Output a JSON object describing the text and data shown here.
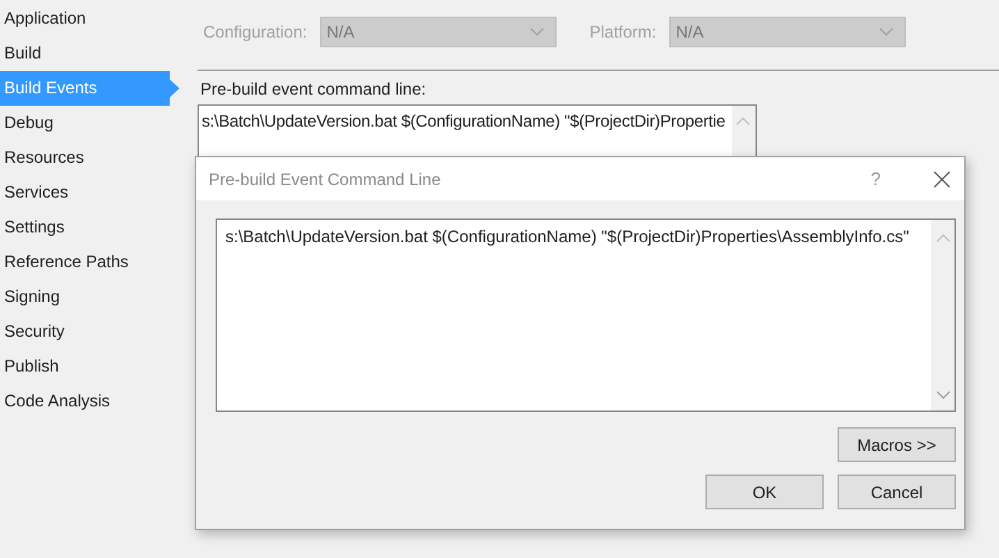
{
  "sidebar": {
    "items": [
      {
        "label": "Application",
        "selected": false
      },
      {
        "label": "Build",
        "selected": false
      },
      {
        "label": "Build Events",
        "selected": true
      },
      {
        "label": "Debug",
        "selected": false
      },
      {
        "label": "Resources",
        "selected": false
      },
      {
        "label": "Services",
        "selected": false
      },
      {
        "label": "Settings",
        "selected": false
      },
      {
        "label": "Reference Paths",
        "selected": false
      },
      {
        "label": "Signing",
        "selected": false
      },
      {
        "label": "Security",
        "selected": false
      },
      {
        "label": "Publish",
        "selected": false
      },
      {
        "label": "Code Analysis",
        "selected": false
      }
    ]
  },
  "selectors": [
    {
      "label": "Configuration:",
      "value": "N/A",
      "disabled": true
    },
    {
      "label": "Platform:",
      "value": "N/A",
      "disabled": true
    }
  ],
  "prebuild": {
    "label": "Pre-build event command line:",
    "value": "s:\\Batch\\UpdateVersion.bat $(ConfigurationName) \"$(ProjectDir)Propertie"
  },
  "dialog": {
    "title": "Pre-build Event Command Line",
    "help": "?",
    "value": "s:\\Batch\\UpdateVersion.bat $(ConfigurationName) \"$(ProjectDir)Properties\\AssemblyInfo.cs\"",
    "macros_button": "Macros >>",
    "buttons": [
      "OK",
      "Cancel"
    ]
  }
}
